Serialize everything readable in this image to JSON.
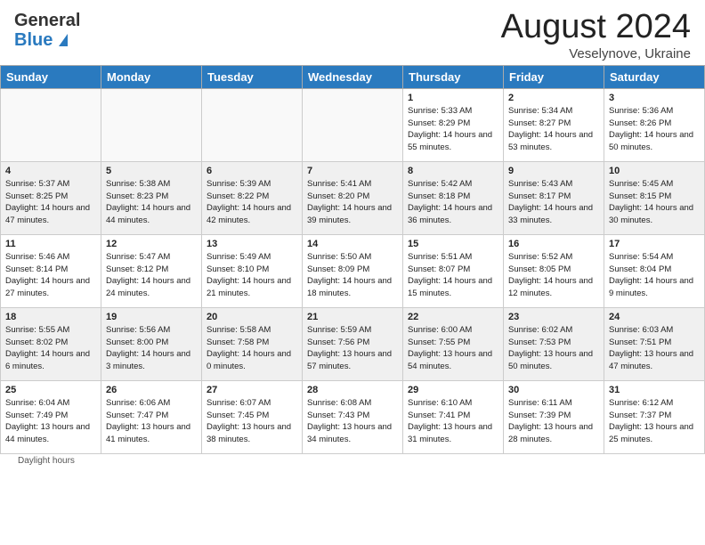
{
  "header": {
    "logo_general": "General",
    "logo_blue": "Blue",
    "month_title": "August 2024",
    "location": "Veselynove, Ukraine"
  },
  "calendar": {
    "days_of_week": [
      "Sunday",
      "Monday",
      "Tuesday",
      "Wednesday",
      "Thursday",
      "Friday",
      "Saturday"
    ],
    "weeks": [
      [
        {
          "day": "",
          "empty": true
        },
        {
          "day": "",
          "empty": true
        },
        {
          "day": "",
          "empty": true
        },
        {
          "day": "",
          "empty": true
        },
        {
          "day": "1",
          "sunrise": "5:33 AM",
          "sunset": "8:29 PM",
          "daylight": "14 hours and 55 minutes."
        },
        {
          "day": "2",
          "sunrise": "5:34 AM",
          "sunset": "8:27 PM",
          "daylight": "14 hours and 53 minutes."
        },
        {
          "day": "3",
          "sunrise": "5:36 AM",
          "sunset": "8:26 PM",
          "daylight": "14 hours and 50 minutes."
        }
      ],
      [
        {
          "day": "4",
          "sunrise": "5:37 AM",
          "sunset": "8:25 PM",
          "daylight": "14 hours and 47 minutes."
        },
        {
          "day": "5",
          "sunrise": "5:38 AM",
          "sunset": "8:23 PM",
          "daylight": "14 hours and 44 minutes."
        },
        {
          "day": "6",
          "sunrise": "5:39 AM",
          "sunset": "8:22 PM",
          "daylight": "14 hours and 42 minutes."
        },
        {
          "day": "7",
          "sunrise": "5:41 AM",
          "sunset": "8:20 PM",
          "daylight": "14 hours and 39 minutes."
        },
        {
          "day": "8",
          "sunrise": "5:42 AM",
          "sunset": "8:18 PM",
          "daylight": "14 hours and 36 minutes."
        },
        {
          "day": "9",
          "sunrise": "5:43 AM",
          "sunset": "8:17 PM",
          "daylight": "14 hours and 33 minutes."
        },
        {
          "day": "10",
          "sunrise": "5:45 AM",
          "sunset": "8:15 PM",
          "daylight": "14 hours and 30 minutes."
        }
      ],
      [
        {
          "day": "11",
          "sunrise": "5:46 AM",
          "sunset": "8:14 PM",
          "daylight": "14 hours and 27 minutes."
        },
        {
          "day": "12",
          "sunrise": "5:47 AM",
          "sunset": "8:12 PM",
          "daylight": "14 hours and 24 minutes."
        },
        {
          "day": "13",
          "sunrise": "5:49 AM",
          "sunset": "8:10 PM",
          "daylight": "14 hours and 21 minutes."
        },
        {
          "day": "14",
          "sunrise": "5:50 AM",
          "sunset": "8:09 PM",
          "daylight": "14 hours and 18 minutes."
        },
        {
          "day": "15",
          "sunrise": "5:51 AM",
          "sunset": "8:07 PM",
          "daylight": "14 hours and 15 minutes."
        },
        {
          "day": "16",
          "sunrise": "5:52 AM",
          "sunset": "8:05 PM",
          "daylight": "14 hours and 12 minutes."
        },
        {
          "day": "17",
          "sunrise": "5:54 AM",
          "sunset": "8:04 PM",
          "daylight": "14 hours and 9 minutes."
        }
      ],
      [
        {
          "day": "18",
          "sunrise": "5:55 AM",
          "sunset": "8:02 PM",
          "daylight": "14 hours and 6 minutes."
        },
        {
          "day": "19",
          "sunrise": "5:56 AM",
          "sunset": "8:00 PM",
          "daylight": "14 hours and 3 minutes."
        },
        {
          "day": "20",
          "sunrise": "5:58 AM",
          "sunset": "7:58 PM",
          "daylight": "14 hours and 0 minutes."
        },
        {
          "day": "21",
          "sunrise": "5:59 AM",
          "sunset": "7:56 PM",
          "daylight": "13 hours and 57 minutes."
        },
        {
          "day": "22",
          "sunrise": "6:00 AM",
          "sunset": "7:55 PM",
          "daylight": "13 hours and 54 minutes."
        },
        {
          "day": "23",
          "sunrise": "6:02 AM",
          "sunset": "7:53 PM",
          "daylight": "13 hours and 50 minutes."
        },
        {
          "day": "24",
          "sunrise": "6:03 AM",
          "sunset": "7:51 PM",
          "daylight": "13 hours and 47 minutes."
        }
      ],
      [
        {
          "day": "25",
          "sunrise": "6:04 AM",
          "sunset": "7:49 PM",
          "daylight": "13 hours and 44 minutes."
        },
        {
          "day": "26",
          "sunrise": "6:06 AM",
          "sunset": "7:47 PM",
          "daylight": "13 hours and 41 minutes."
        },
        {
          "day": "27",
          "sunrise": "6:07 AM",
          "sunset": "7:45 PM",
          "daylight": "13 hours and 38 minutes."
        },
        {
          "day": "28",
          "sunrise": "6:08 AM",
          "sunset": "7:43 PM",
          "daylight": "13 hours and 34 minutes."
        },
        {
          "day": "29",
          "sunrise": "6:10 AM",
          "sunset": "7:41 PM",
          "daylight": "13 hours and 31 minutes."
        },
        {
          "day": "30",
          "sunrise": "6:11 AM",
          "sunset": "7:39 PM",
          "daylight": "13 hours and 28 minutes."
        },
        {
          "day": "31",
          "sunrise": "6:12 AM",
          "sunset": "7:37 PM",
          "daylight": "13 hours and 25 minutes."
        }
      ]
    ]
  },
  "footer": {
    "daylight_label": "Daylight hours"
  }
}
